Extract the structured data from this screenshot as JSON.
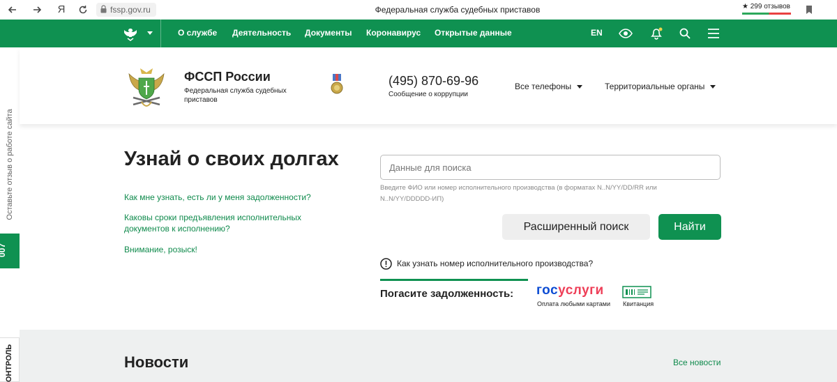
{
  "browser": {
    "url": "fssp.gov.ru",
    "window_title": "Федеральная служба судебных приставов",
    "reviews": "★ 299 отзывов",
    "yandex_glyph": "Я"
  },
  "nav": {
    "items": [
      "О службе",
      "Деятельность",
      "Документы",
      "Коронавирус",
      "Открытые данные"
    ],
    "lang": "EN"
  },
  "header": {
    "org_name": "ФССП России",
    "org_sub": "Федеральная служба судебных приставов",
    "phone": "(495) 870-69-96",
    "phone_sub": "Сообщение о коррупции",
    "phones_dropdown": "Все телефоны",
    "territorial_dropdown": "Территориальные органы"
  },
  "side": {
    "feedback": "Оставьте отзыв о работе сайта",
    "code": "007",
    "control": "ОНТРОЛЬ"
  },
  "main": {
    "title": "Узнай о своих долгах",
    "links": [
      "Как мне узнать, есть ли у меня задолженности?",
      "Каковы сроки предъявления исполнительных документов к исполнению?",
      "Внимание, розыск!"
    ],
    "search_placeholder": "Данные для поиска",
    "search_hint": "Введите ФИО или номер исполнительного производства (в форматах N..N/YY/DD/RR или N..N/YY/DDDDD-ИП)",
    "advanced_button": "Расширенный поиск",
    "find_button": "Найти",
    "info_text": "Как узнать номер исполнительного производства?",
    "pay_label": "Погасите задолженность:",
    "gosuslugi_part1": "гос",
    "gosuslugi_part2": "услуги",
    "gosuslugi_sub": "Оплата любыми картами",
    "receipt_sub": "Квитанция"
  },
  "news": {
    "title": "Новости",
    "all_link": "Все новости"
  },
  "colors": {
    "brand_green": "#0f9151",
    "link_green": "#0f8a4c",
    "gos_blue": "#0d4cd3",
    "gos_red": "#ee3f58"
  }
}
